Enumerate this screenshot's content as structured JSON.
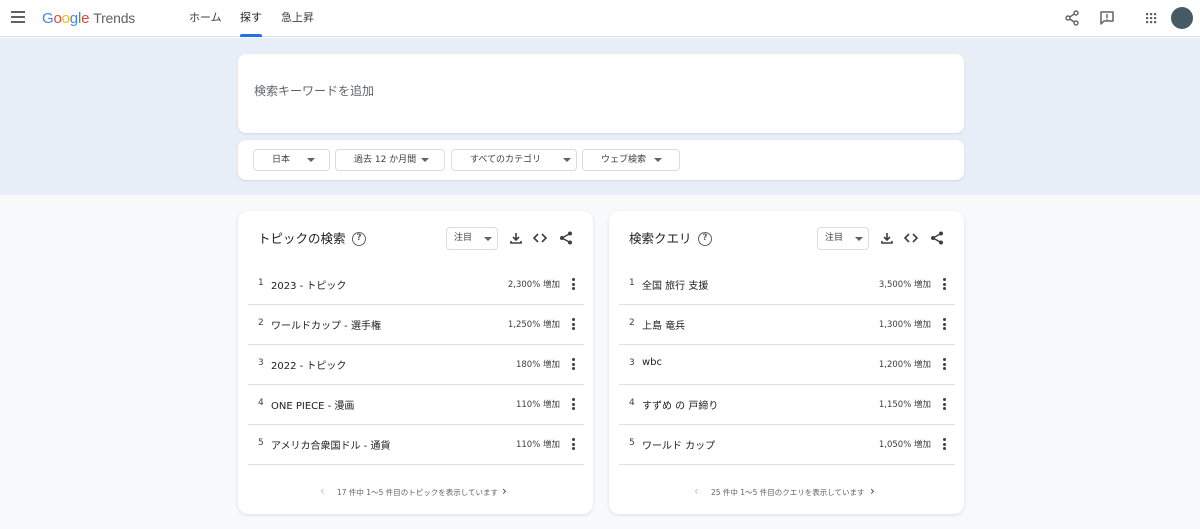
{
  "header": {
    "logo": [
      "G",
      "o",
      "o",
      "g",
      "l",
      "e"
    ],
    "logo_suffix": "Trends",
    "tabs": [
      "ホーム",
      "探す",
      "急上昇"
    ],
    "active_tab": "探す"
  },
  "search": {
    "placeholder": "検索キーワードを追加"
  },
  "filters": [
    "日本",
    "過去 12 か月間",
    "すべてのカテゴリ",
    "ウェブ検索"
  ],
  "topics": {
    "title": "トピックの検索",
    "sort": "注目",
    "rows": [
      {
        "rank": "1",
        "name": "2023 - トピック",
        "value": "2,300% 増加"
      },
      {
        "rank": "2",
        "name": "ワールドカップ - 選手権",
        "value": "1,250% 増加"
      },
      {
        "rank": "3",
        "name": "2022 - トピック",
        "value": "180% 増加"
      },
      {
        "rank": "4",
        "name": "ONE PIECE - 漫画",
        "value": "110% 増加"
      },
      {
        "rank": "5",
        "name": "アメリカ合衆国ドル - 通貨",
        "value": "110% 増加"
      }
    ],
    "pager": "17 件中 1～5 件目のトピックを表示しています"
  },
  "queries": {
    "title": "検索クエリ",
    "sort": "注目",
    "rows": [
      {
        "rank": "1",
        "name": "全国 旅行 支援",
        "value": "3,500% 増加"
      },
      {
        "rank": "2",
        "name": "上島 竜兵",
        "value": "1,300% 増加"
      },
      {
        "rank": "3",
        "name": "wbc",
        "value": "1,200% 増加"
      },
      {
        "rank": "4",
        "name": "すずめ の 戸締り",
        "value": "1,150% 増加"
      },
      {
        "rank": "5",
        "name": "ワールド カップ",
        "value": "1,050% 増加"
      }
    ],
    "pager": "25 件中 1～5 件目のクエリを表示しています"
  }
}
